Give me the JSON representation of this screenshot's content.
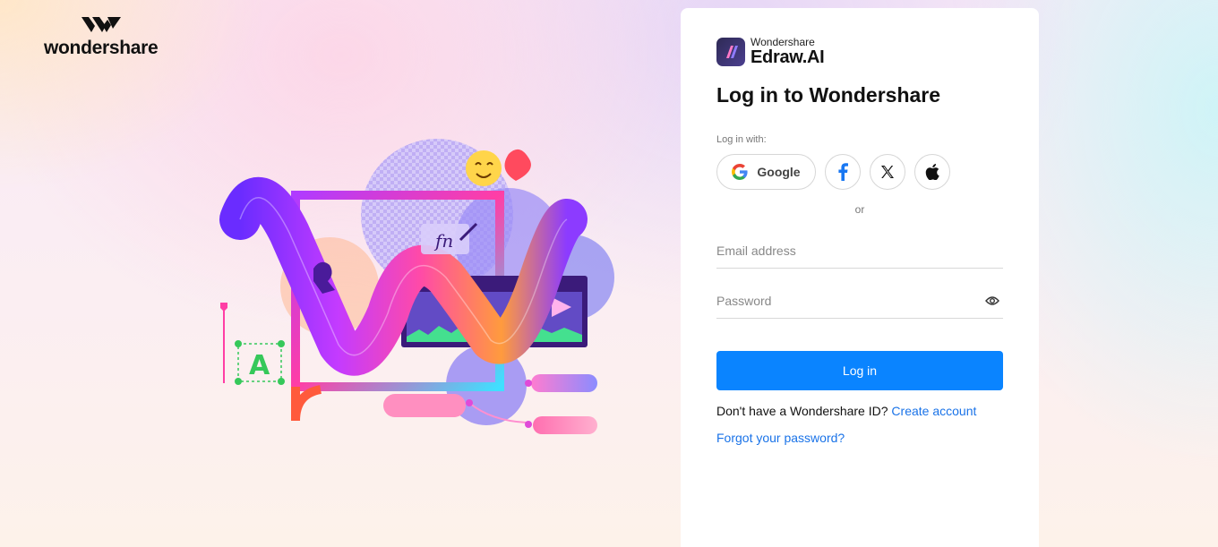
{
  "brand": {
    "logo_icon": "wondershare-logo-icon",
    "name": "wondershare"
  },
  "illustration": {
    "icon": "creative-hero-illustration",
    "text_frame_letter": "A",
    "signature_text": "fn"
  },
  "card": {
    "product": {
      "icon": "edraw-ai-logo-icon",
      "company": "Wondershare",
      "name": "Edraw.AI"
    },
    "title": "Log in to Wondershare",
    "login_with_label": "Log in with:",
    "social": [
      {
        "id": "google",
        "label": "Google",
        "icon": "google-icon"
      },
      {
        "id": "facebook",
        "icon": "facebook-icon"
      },
      {
        "id": "x",
        "icon": "x-icon"
      },
      {
        "id": "apple",
        "icon": "apple-icon"
      }
    ],
    "or_label": "or",
    "email": {
      "placeholder": "Email address",
      "value": ""
    },
    "password": {
      "placeholder": "Password",
      "value": "",
      "toggle_icon": "eye-icon"
    },
    "login_button": "Log in",
    "signup_prompt": "Don't have a Wondershare ID?",
    "signup_link": "Create account",
    "forgot_link": "Forgot your password?"
  },
  "colors": {
    "primary": "#0A84FF",
    "link": "#1A73E8",
    "title": "#111111"
  }
}
